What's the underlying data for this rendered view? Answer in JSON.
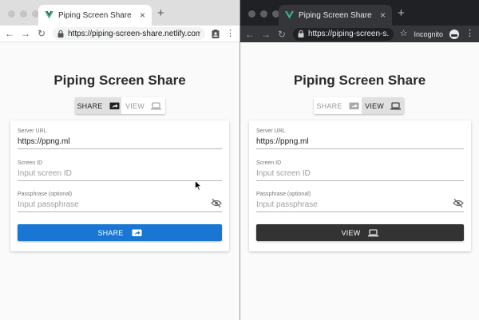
{
  "colors": {
    "share_accent": "#1976d2",
    "view_accent": "#333333",
    "vue_green": "#41b883",
    "vue_dark": "#35495e"
  },
  "left": {
    "tab_title": "Piping Screen Share",
    "tab_close": "×",
    "new_tab": "+",
    "nav": {
      "back": "←",
      "forward": "→",
      "reload": "↻"
    },
    "url": "https://piping-screen-share.netlify.com",
    "menu": "⋮",
    "app_title": "Piping Screen Share",
    "toggle": {
      "share": "SHARE",
      "view": "VIEW",
      "active": "share"
    },
    "fields": {
      "server_url": {
        "label": "Server URL",
        "value": "https://ppng.ml"
      },
      "screen_id": {
        "label": "Screen ID",
        "placeholder": "Input screen ID"
      },
      "passphrase": {
        "label": "Passphrase (optional)",
        "placeholder": "Input passphrase"
      }
    },
    "action_button": "SHARE"
  },
  "right": {
    "tab_title": "Piping Screen Share",
    "tab_close": "×",
    "new_tab": "+",
    "nav": {
      "back": "←",
      "forward": "→",
      "reload": "↻"
    },
    "url": "https://piping-screen-s...",
    "star": "☆",
    "incognito_label": "Incognito",
    "menu": "⋮",
    "app_title": "Piping Screen Share",
    "toggle": {
      "share": "SHARE",
      "view": "VIEW",
      "active": "view"
    },
    "fields": {
      "server_url": {
        "label": "Server URL",
        "value": "https://ppng.ml"
      },
      "screen_id": {
        "label": "Screen ID",
        "placeholder": "Input screen ID"
      },
      "passphrase": {
        "label": "Passphrase (optional)",
        "placeholder": "Input passphrase"
      }
    },
    "action_button": "VIEW"
  }
}
